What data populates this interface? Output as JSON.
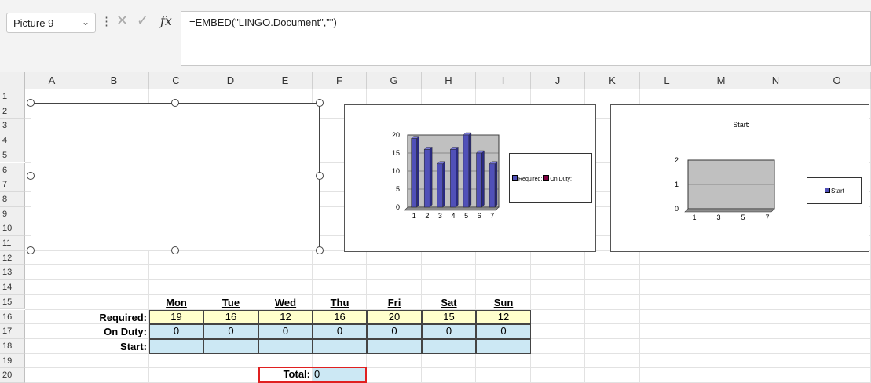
{
  "formula_bar": {
    "name_box": "Picture 9",
    "formula": "=EMBED(\"LINGO.Document\",\"\")"
  },
  "columns": [
    "A",
    "B",
    "C",
    "D",
    "E",
    "F",
    "G",
    "H",
    "I",
    "J",
    "K",
    "L",
    "M",
    "N",
    "O"
  ],
  "rows": [
    "1",
    "2",
    "3",
    "4",
    "5",
    "6",
    "7",
    "8",
    "9",
    "10",
    "11",
    "12",
    "13",
    "14",
    "15",
    "16",
    "17",
    "18",
    "19",
    "20"
  ],
  "table": {
    "days": [
      "Mon",
      "Tue",
      "Wed",
      "Thu",
      "Fri",
      "Sat",
      "Sun"
    ],
    "required_label": "Required:",
    "onduty_label": "On Duty:",
    "start_label": "Start:",
    "required": [
      "19",
      "16",
      "12",
      "16",
      "20",
      "15",
      "12"
    ],
    "onduty": [
      "0",
      "0",
      "0",
      "0",
      "0",
      "0",
      "0"
    ],
    "total_label": "Total:",
    "total_value": "0"
  },
  "chart_data": [
    {
      "type": "bar",
      "categories": [
        "1",
        "2",
        "3",
        "4",
        "5",
        "6",
        "7"
      ],
      "series": [
        {
          "name": "Required",
          "values": [
            19,
            16,
            12,
            16,
            20,
            15,
            12
          ]
        },
        {
          "name": "On Duty",
          "values": [
            0,
            0,
            0,
            0,
            0,
            0,
            0
          ]
        }
      ],
      "yticks": [
        "0",
        "5",
        "10",
        "15",
        "20"
      ],
      "ylim": [
        0,
        20
      ],
      "legend": [
        "Required:",
        "On Duty:"
      ],
      "legend_position": "right",
      "colors": {
        "required": "#5050b8",
        "onduty": "#800040",
        "plot_bg": "#c0c0c0"
      }
    },
    {
      "type": "bar",
      "title": "Start:",
      "categories": [
        "1",
        "3",
        "5",
        "7"
      ],
      "series": [
        {
          "name": "Start",
          "values": []
        }
      ],
      "yticks": [
        "0",
        "1",
        "2"
      ],
      "ylim": [
        0,
        2
      ],
      "legend": [
        "Start"
      ],
      "legend_position": "right"
    }
  ],
  "colors": {
    "required_fill": "#ffffcc",
    "blue_fill": "#cce8f4",
    "total_border": "#e02020"
  }
}
